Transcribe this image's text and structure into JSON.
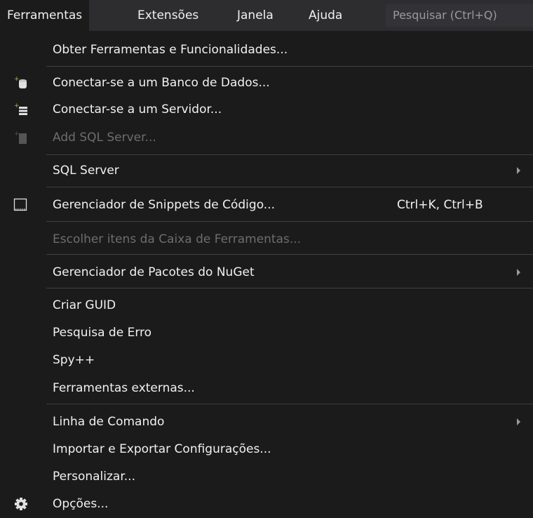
{
  "menubar": {
    "items": [
      "Ferramentas",
      "Extensões",
      "Janela",
      "Ajuda"
    ],
    "search_placeholder": "Pesquisar (Ctrl+Q)"
  },
  "menu": {
    "get_tools": "Obter Ferramentas e Funcionalidades...",
    "connect_db": "Conectar-se a um Banco de Dados...",
    "connect_server": "Conectar-se a um Servidor...",
    "add_sql_server": "Add SQL Server...",
    "sql_server": "SQL Server",
    "snippets_manager": "Gerenciador de Snippets de Código...",
    "snippets_shortcut": "Ctrl+K, Ctrl+B",
    "choose_toolbox": "Escolher itens da Caixa de Ferramentas...",
    "nuget": "Gerenciador de Pacotes do NuGet",
    "create_guid": "Criar GUID",
    "error_lookup": "Pesquisa de Erro",
    "spy": "Spy++",
    "external_tools": "Ferramentas externas...",
    "command_line": "Linha de Comando",
    "import_export": "Importar e Exportar Configurações...",
    "customize": "Personalizar...",
    "options": "Opções..."
  },
  "colors": {
    "background": "#1b1b1c",
    "menubar": "#2d2d30",
    "text": "#f1f1f1",
    "disabled_text": "#6d6d6d",
    "separator": "#3f3f46",
    "icon_green": "#8bc34a"
  }
}
